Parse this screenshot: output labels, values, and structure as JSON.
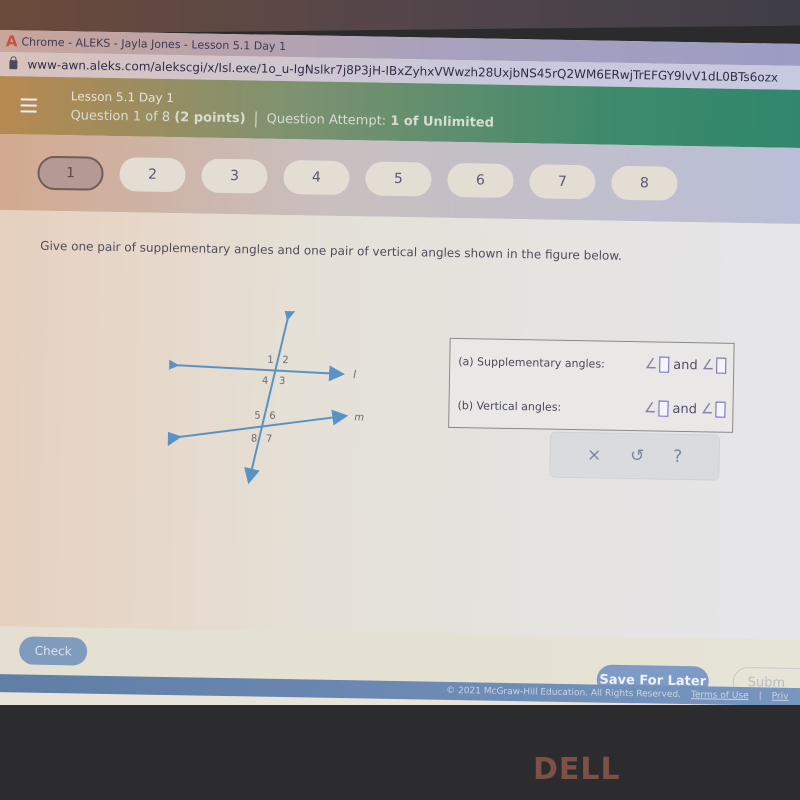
{
  "browser": {
    "window_title": "Chrome - ALEKS - Jayla Jones - Lesson 5.1 Day 1",
    "logo_glyph": "A",
    "url": "www-awn.aleks.com/alekscgi/x/Isl.exe/1o_u-IgNslkr7j8P3jH-IBxZyhxVWwzh28UxjbNS45rQ2WM6ERwjTrEFGY9lvV1dL0BTs6ozx"
  },
  "header": {
    "menu_icon": "hamburger-menu-icon",
    "lesson": "Lesson 5.1 Day 1",
    "question_of": "Question 1 of 8",
    "points": "(2 points)",
    "attempt_label": "Question Attempt:",
    "attempt_value": "1 of Unlimited"
  },
  "question_nav": {
    "active": 1,
    "items": [
      "1",
      "2",
      "3",
      "4",
      "5",
      "6",
      "7",
      "8"
    ]
  },
  "question": {
    "prompt": "Give one pair of supplementary angles and one pair of vertical angles shown in the figure below.",
    "figure": {
      "line_labels": [
        "l",
        "m"
      ],
      "angle_labels": [
        "1",
        "2",
        "3",
        "4",
        "5",
        "6",
        "7",
        "8"
      ],
      "line_color": "#5b92c4"
    }
  },
  "answer": {
    "supplementary_label": "(a) Supplementary angles:",
    "vertical_label": "(b) Vertical angles:",
    "angle_symbol": "∠",
    "and_word": "and",
    "supplementary_values": [
      "",
      ""
    ],
    "vertical_values": [
      "",
      ""
    ]
  },
  "tools": {
    "clear": "×",
    "undo": "↺",
    "help": "?"
  },
  "buttons": {
    "check": "Check",
    "save_for_later": "Save For Later",
    "submit": "Subm"
  },
  "footer": {
    "copyright": "© 2021 McGraw-Hill Education. All Rights Reserved.",
    "terms": "Terms of Use",
    "separator": "|",
    "privacy": "Priv"
  },
  "device": {
    "brand": "DELL"
  },
  "colors": {
    "header_green": "#2f876d",
    "primary_button": "#7d9bc6",
    "slot_border": "#6b66b8"
  }
}
